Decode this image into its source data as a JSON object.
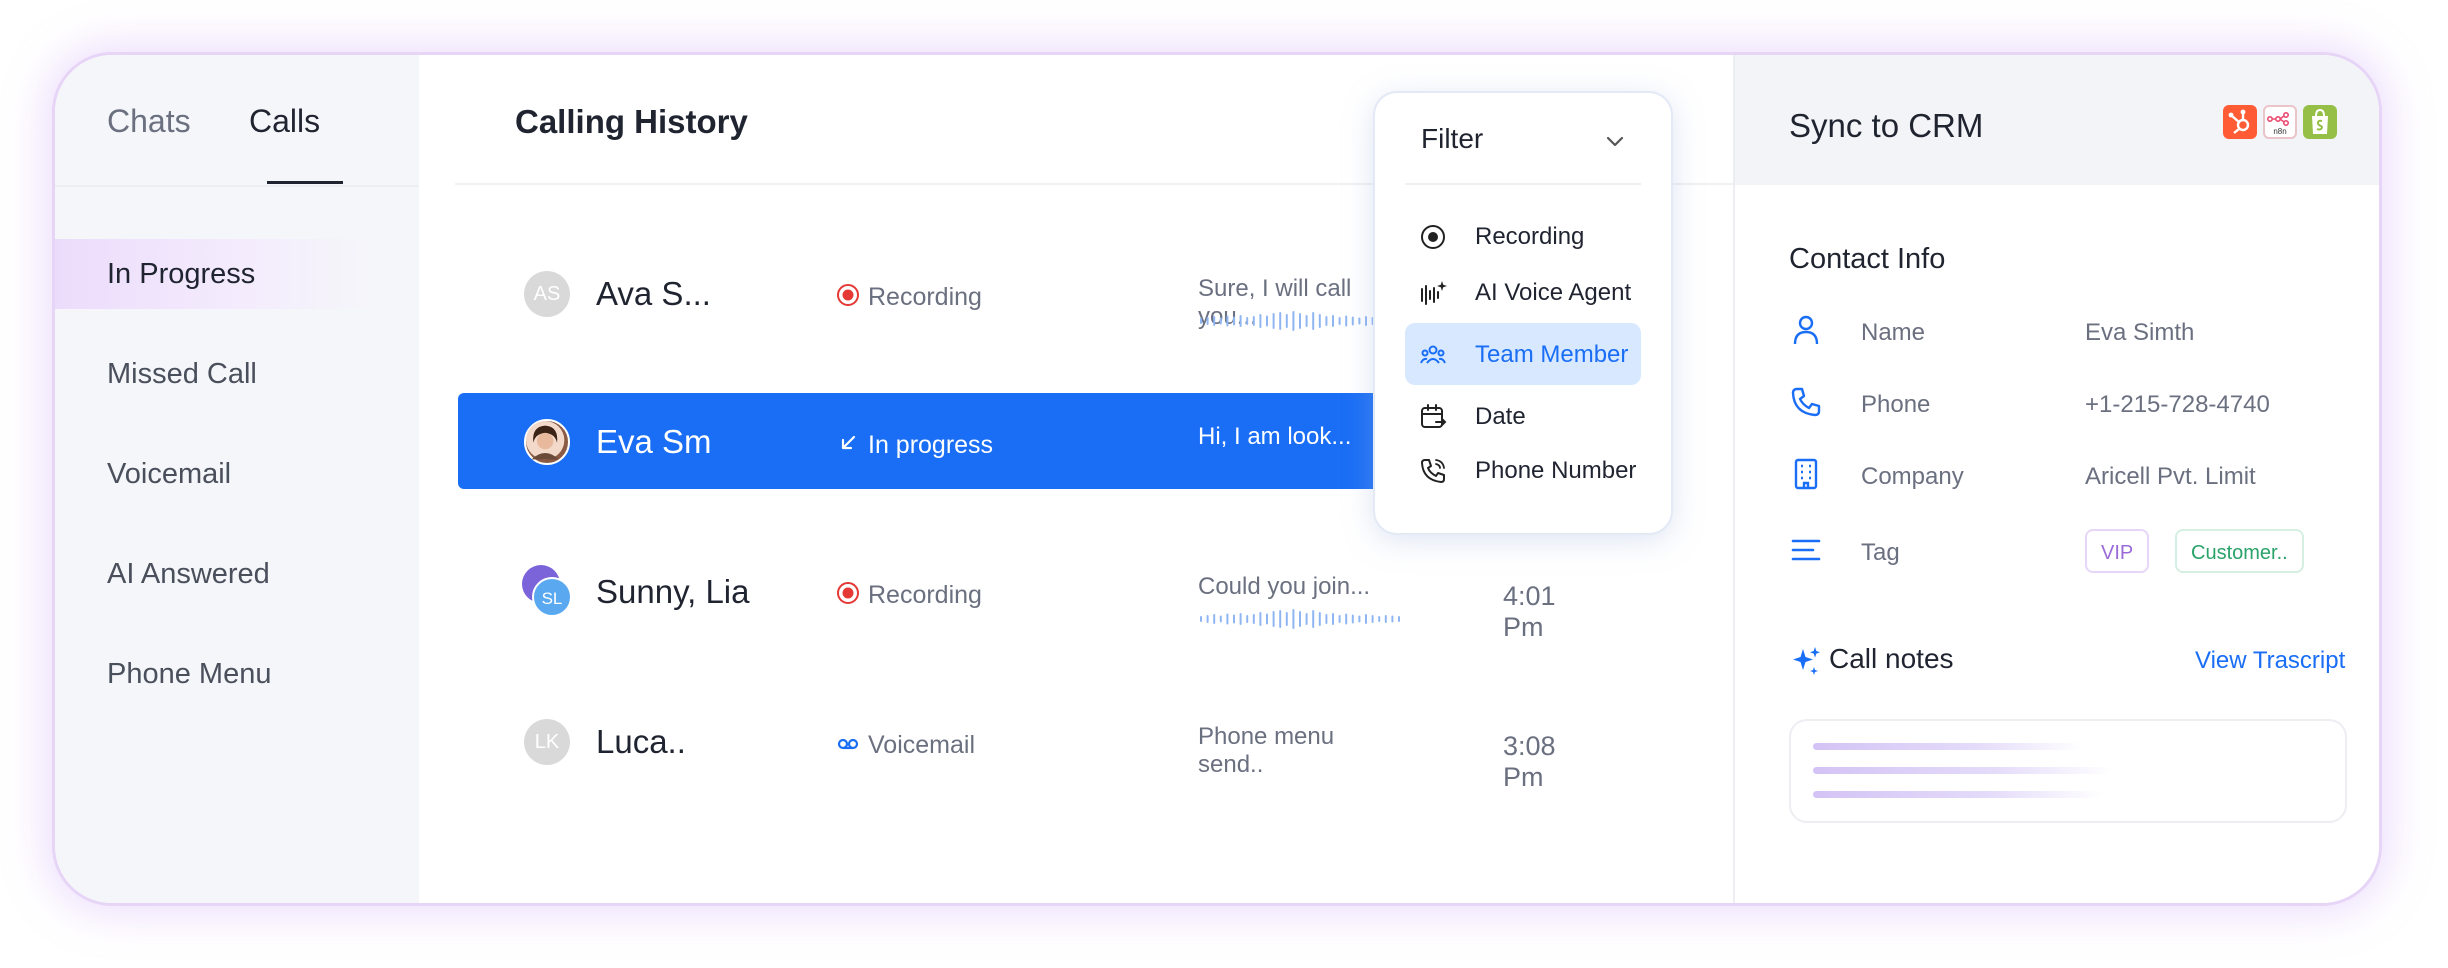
{
  "nav": {
    "tabs": [
      {
        "label": "Chats"
      },
      {
        "label": "Calls"
      }
    ],
    "items": [
      {
        "label": "In Progress"
      },
      {
        "label": "Missed Call"
      },
      {
        "label": "Voicemail"
      },
      {
        "label": "AI Answered"
      },
      {
        "label": "Phone Menu"
      }
    ]
  },
  "history": {
    "title": "Calling History",
    "rows": [
      {
        "initials": "AS",
        "name": "Ava S...",
        "status": "Recording",
        "status_icon": "record-icon",
        "message": "Sure, I will call you...",
        "time": ""
      },
      {
        "initials": "",
        "name": "Eva Sm",
        "status": "In progress",
        "status_icon": "arrow-down-left-icon",
        "message": "Hi, I am look...",
        "time": ""
      },
      {
        "initials": "SL",
        "name": "Sunny, Lia",
        "status": "Recording",
        "status_icon": "record-icon",
        "message": "Could you join...",
        "time": "4:01 Pm"
      },
      {
        "initials": "LK",
        "name": "Luca..",
        "status": "Voicemail",
        "status_icon": "voicemail-icon",
        "message": "Phone menu send..",
        "time": "3:08 Pm"
      }
    ]
  },
  "filter": {
    "title": "Filter",
    "options": [
      {
        "label": "Recording",
        "icon": "radio-icon"
      },
      {
        "label": "AI Voice Agent",
        "icon": "soundwave-sparkle-icon"
      },
      {
        "label": "Team Member",
        "icon": "team-icon",
        "highlighted": true
      },
      {
        "label": "Date",
        "icon": "calendar-icon"
      },
      {
        "label": "Phone Number",
        "icon": "phone-icon"
      }
    ]
  },
  "crm": {
    "title": "Sync to CRM",
    "integrations": [
      "hubspot-logo",
      "n8n-logo",
      "shopify-logo"
    ],
    "n8n_text": "n8n",
    "contact_title": "Contact Info",
    "fields": [
      {
        "label": "Name",
        "value": "Eva Simth",
        "icon": "user-icon"
      },
      {
        "label": "Phone",
        "value": "+1-215-728-4740",
        "icon": "phone-icon"
      },
      {
        "label": "Company",
        "value": "Aricell Pvt. Limit",
        "icon": "building-icon"
      },
      {
        "label": "Tag",
        "value": "",
        "icon": "lines-icon"
      }
    ],
    "tags": [
      "VIP",
      "Customer.."
    ],
    "notes_title": "Call notes",
    "transcript_link": "View Trascript"
  },
  "colors": {
    "accent": "#1a6ef5",
    "recording": "#e53935",
    "highlight": "#d7e8ff",
    "nav_selected": "#ecdcfb"
  }
}
